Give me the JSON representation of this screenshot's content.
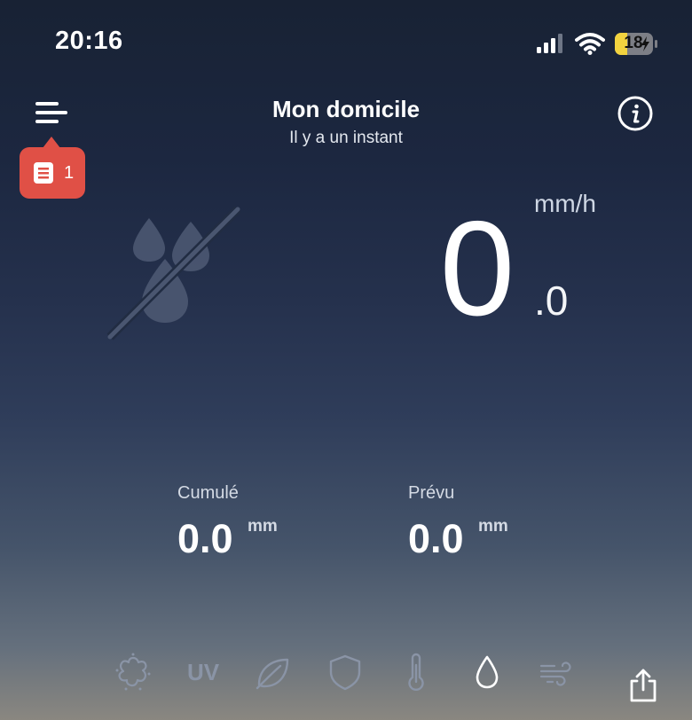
{
  "status_bar": {
    "time": "20:16",
    "battery_level": "18"
  },
  "header": {
    "title": "Mon domicile",
    "subtitle": "Il y a un instant"
  },
  "badge": {
    "count": "1"
  },
  "current": {
    "integer": "0",
    "decimal": ".0",
    "unit": "mm/h"
  },
  "stats": {
    "cumulated": {
      "label": "Cumulé",
      "value": "0.0",
      "unit": "mm"
    },
    "forecast": {
      "label": "Prévu",
      "value": "0.0",
      "unit": "mm"
    }
  },
  "categories": [
    {
      "icon": "pollen-icon"
    },
    {
      "icon": "uv-icon",
      "label": "UV"
    },
    {
      "icon": "leaf-icon"
    },
    {
      "icon": "shield-icon"
    },
    {
      "icon": "thermometer-icon"
    },
    {
      "icon": "water-drop-icon",
      "active": true
    },
    {
      "icon": "wind-icon"
    }
  ],
  "colors": {
    "badge": "#e05046",
    "inactive_icon": "#8a94a6",
    "active_icon": "#ffffff"
  }
}
